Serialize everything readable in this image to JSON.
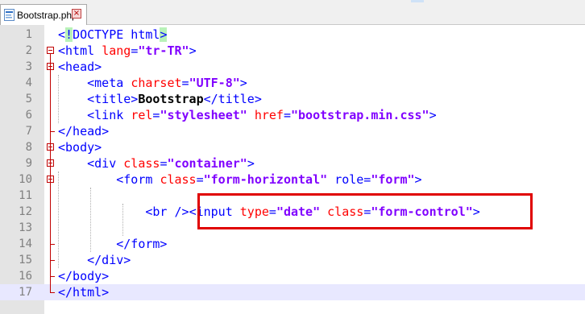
{
  "tab": {
    "label": "Bootstrap.php"
  },
  "lines": [
    {
      "num": "1",
      "tokens": [
        {
          "c": "tag",
          "t": "<"
        },
        {
          "c": "hl",
          "t": "!"
        },
        {
          "c": "tag",
          "t": "DOCTYPE html"
        },
        {
          "c": "hl",
          "t": ">"
        }
      ]
    },
    {
      "num": "2",
      "tokens": [
        {
          "c": "tag",
          "t": "<html "
        },
        {
          "c": "attr",
          "t": "lang"
        },
        {
          "c": "tag",
          "t": "="
        },
        {
          "c": "val",
          "t": "\"tr-TR\""
        },
        {
          "c": "tag",
          "t": ">"
        }
      ]
    },
    {
      "num": "3",
      "tokens": [
        {
          "c": "tag",
          "t": "<head>"
        }
      ]
    },
    {
      "num": "4",
      "tokens": [
        {
          "c": "plain",
          "t": "    "
        },
        {
          "c": "tag",
          "t": "<meta "
        },
        {
          "c": "attr",
          "t": "charset"
        },
        {
          "c": "tag",
          "t": "="
        },
        {
          "c": "val",
          "t": "\"UTF-8\""
        },
        {
          "c": "tag",
          "t": ">"
        }
      ]
    },
    {
      "num": "5",
      "tokens": [
        {
          "c": "plain",
          "t": "    "
        },
        {
          "c": "tag",
          "t": "<title>"
        },
        {
          "c": "txt",
          "t": "Bootstrap"
        },
        {
          "c": "tag",
          "t": "</title>"
        }
      ]
    },
    {
      "num": "6",
      "tokens": [
        {
          "c": "plain",
          "t": "    "
        },
        {
          "c": "tag",
          "t": "<link "
        },
        {
          "c": "attr",
          "t": "rel"
        },
        {
          "c": "tag",
          "t": "="
        },
        {
          "c": "val",
          "t": "\"stylesheet\""
        },
        {
          "c": "plain",
          "t": " "
        },
        {
          "c": "attr",
          "t": "href"
        },
        {
          "c": "tag",
          "t": "="
        },
        {
          "c": "val",
          "t": "\"bootstrap.min.css\""
        },
        {
          "c": "tag",
          "t": ">"
        }
      ]
    },
    {
      "num": "7",
      "tokens": [
        {
          "c": "tag",
          "t": "</head>"
        }
      ]
    },
    {
      "num": "8",
      "tokens": [
        {
          "c": "tag",
          "t": "<body>"
        }
      ]
    },
    {
      "num": "9",
      "tokens": [
        {
          "c": "plain",
          "t": "    "
        },
        {
          "c": "tag",
          "t": "<div "
        },
        {
          "c": "attr",
          "t": "class"
        },
        {
          "c": "tag",
          "t": "="
        },
        {
          "c": "val",
          "t": "\"container\""
        },
        {
          "c": "tag",
          "t": ">"
        }
      ]
    },
    {
      "num": "10",
      "tokens": [
        {
          "c": "plain",
          "t": "        "
        },
        {
          "c": "tag",
          "t": "<form "
        },
        {
          "c": "attr",
          "t": "class"
        },
        {
          "c": "tag",
          "t": "="
        },
        {
          "c": "val",
          "t": "\"form-horizontal\""
        },
        {
          "c": "plain",
          "t": " "
        },
        {
          "c": "tag",
          "t": "role="
        },
        {
          "c": "val",
          "t": "\"form\""
        },
        {
          "c": "tag",
          "t": ">"
        }
      ]
    },
    {
      "num": "11",
      "tokens": []
    },
    {
      "num": "12",
      "tokens": [
        {
          "c": "plain",
          "t": "            "
        },
        {
          "c": "tag",
          "t": "<br />"
        },
        {
          "c": "tag",
          "t": "<input "
        },
        {
          "c": "attr",
          "t": "type"
        },
        {
          "c": "tag",
          "t": "="
        },
        {
          "c": "val",
          "t": "\"date\""
        },
        {
          "c": "plain",
          "t": " "
        },
        {
          "c": "attr",
          "t": "class"
        },
        {
          "c": "tag",
          "t": "="
        },
        {
          "c": "val",
          "t": "\"form-control\""
        },
        {
          "c": "tag",
          "t": ">"
        }
      ]
    },
    {
      "num": "13",
      "tokens": []
    },
    {
      "num": "14",
      "tokens": [
        {
          "c": "plain",
          "t": "        "
        },
        {
          "c": "tag",
          "t": "</form>"
        }
      ]
    },
    {
      "num": "15",
      "tokens": [
        {
          "c": "plain",
          "t": "    "
        },
        {
          "c": "tag",
          "t": "</div>"
        }
      ]
    },
    {
      "num": "16",
      "tokens": [
        {
          "c": "tag",
          "t": "</body>"
        }
      ]
    },
    {
      "num": "17",
      "tokens": [
        {
          "c": "tag",
          "t": "</html>"
        }
      ]
    }
  ],
  "current_line": "17",
  "colors": {
    "tag": "#0000ff",
    "attribute": "#ff0000",
    "value": "#8000ff",
    "fold_marker": "#c00000",
    "annotation_box": "#e00000"
  },
  "icons": {
    "tab": "php-file-icon",
    "tab_close": "close-icon"
  }
}
